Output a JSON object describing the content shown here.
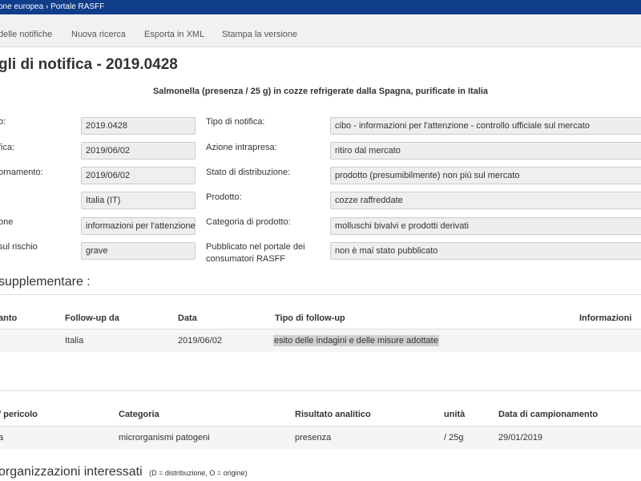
{
  "breadcrumb": {
    "part1": "one europea",
    "separator": "›",
    "part2": "Portale RASFF"
  },
  "nav": {
    "item1": "delle notifiche",
    "item2": "Nuova ricerca",
    "item3": "Esporta in XML",
    "item4": "Stampa la versione"
  },
  "page_title": "gli di notifica - 2019.0428",
  "subject": "Salmonella (presenza / 25 g) in cozze refrigerate dalla Spagna, purificate in Italia",
  "fields_left": [
    {
      "label": "o:",
      "value": "2019.0428"
    },
    {
      "label": "fica:",
      "value": "2019/06/02"
    },
    {
      "label": "ornamento:",
      "value": "2019/06/02"
    },
    {
      "label": "",
      "value": "Italia (IT)"
    },
    {
      "label": "one",
      "value": "informazioni per l'attenzione"
    },
    {
      "label": "sul rischio",
      "value": "grave"
    }
  ],
  "fields_right": [
    {
      "label": "Tipo di notifica:",
      "value": "cibo - informazioni per l'attenzione - controllo ufficiale sul mercato"
    },
    {
      "label": "Azione intrapresa:",
      "value": "ritiro dal mercato"
    },
    {
      "label": "Stato di distribuzione:",
      "value": "prodotto (presumibilmente) non più sul mercato"
    },
    {
      "label": "Prodotto:",
      "value": "cozze raffreddate"
    },
    {
      "label": "Categoria di prodotto:",
      "value": "molluschi bivalvi e prodotti derivati"
    },
    {
      "label_line1": "Pubblicato nel portale dei",
      "label_line2": "consumatori RASFF",
      "value": "non è mai stato pubblicato"
    }
  ],
  "followup": {
    "title": "supplementare :",
    "headers": [
      "anto",
      "Follow-up da",
      "Data",
      "Tipo di follow-up",
      "Informazioni"
    ],
    "row": [
      "Italia",
      "2019/06/02",
      "esito delle indagini e delle misure adottate"
    ]
  },
  "hazards": {
    "headers": [
      "/ pericolo",
      "Categoria",
      "Risultato analitico",
      "unità",
      "Data di campionamento"
    ],
    "row": [
      "a",
      "microrganismi patogeni",
      "presenza",
      "/ 25g",
      "29/01/2019"
    ]
  },
  "organizations": {
    "title": "organizzazioni interessati",
    "note": "(D = distribuzione, O = origine)"
  }
}
